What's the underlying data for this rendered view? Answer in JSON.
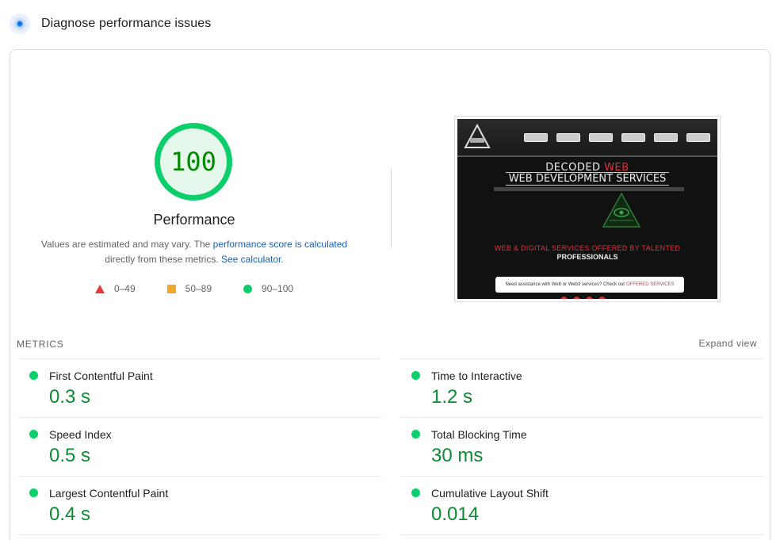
{
  "header": {
    "title": "Diagnose performance issues",
    "icon": "lighthouse-diagnose-icon"
  },
  "score": {
    "value": "100",
    "label": "Performance",
    "color": "#0cce6b"
  },
  "note": {
    "text_before": "Values are estimated and may vary. The ",
    "link1": "performance score is calculated",
    "text_middle": " directly from these metrics. ",
    "link2": "See calculator",
    "text_after": "."
  },
  "legend": [
    {
      "range": "0–49",
      "shape": "triangle",
      "color": "#e53935"
    },
    {
      "range": "50–89",
      "shape": "square",
      "color": "#f4a52c"
    },
    {
      "range": "90–100",
      "shape": "circle",
      "color": "#0cce6b"
    }
  ],
  "thumbnail": {
    "heading_a": "DECODED ",
    "heading_b": "WEB",
    "heading2": "WEB DEVELOPMENT SERVICES",
    "sub1": "WEB & DIGITAL SERVICES OFFERED BY TALENTED",
    "sub2": "PROFESSIONALS",
    "cta_text": "Need assistance with Web or Web3 services? Check out",
    "cta_link": "OFFERED SERVICES"
  },
  "metrics": {
    "label": "METRICS",
    "expand": "Expand view",
    "items": [
      {
        "title": "First Contentful Paint",
        "value": "0.3 s",
        "status": "good"
      },
      {
        "title": "Time to Interactive",
        "value": "1.2 s",
        "status": "good"
      },
      {
        "title": "Speed Index",
        "value": "0.5 s",
        "status": "good"
      },
      {
        "title": "Total Blocking Time",
        "value": "30 ms",
        "status": "good"
      },
      {
        "title": "Largest Contentful Paint",
        "value": "0.4 s",
        "status": "good"
      },
      {
        "title": "Cumulative Layout Shift",
        "value": "0.014",
        "status": "good"
      }
    ]
  }
}
